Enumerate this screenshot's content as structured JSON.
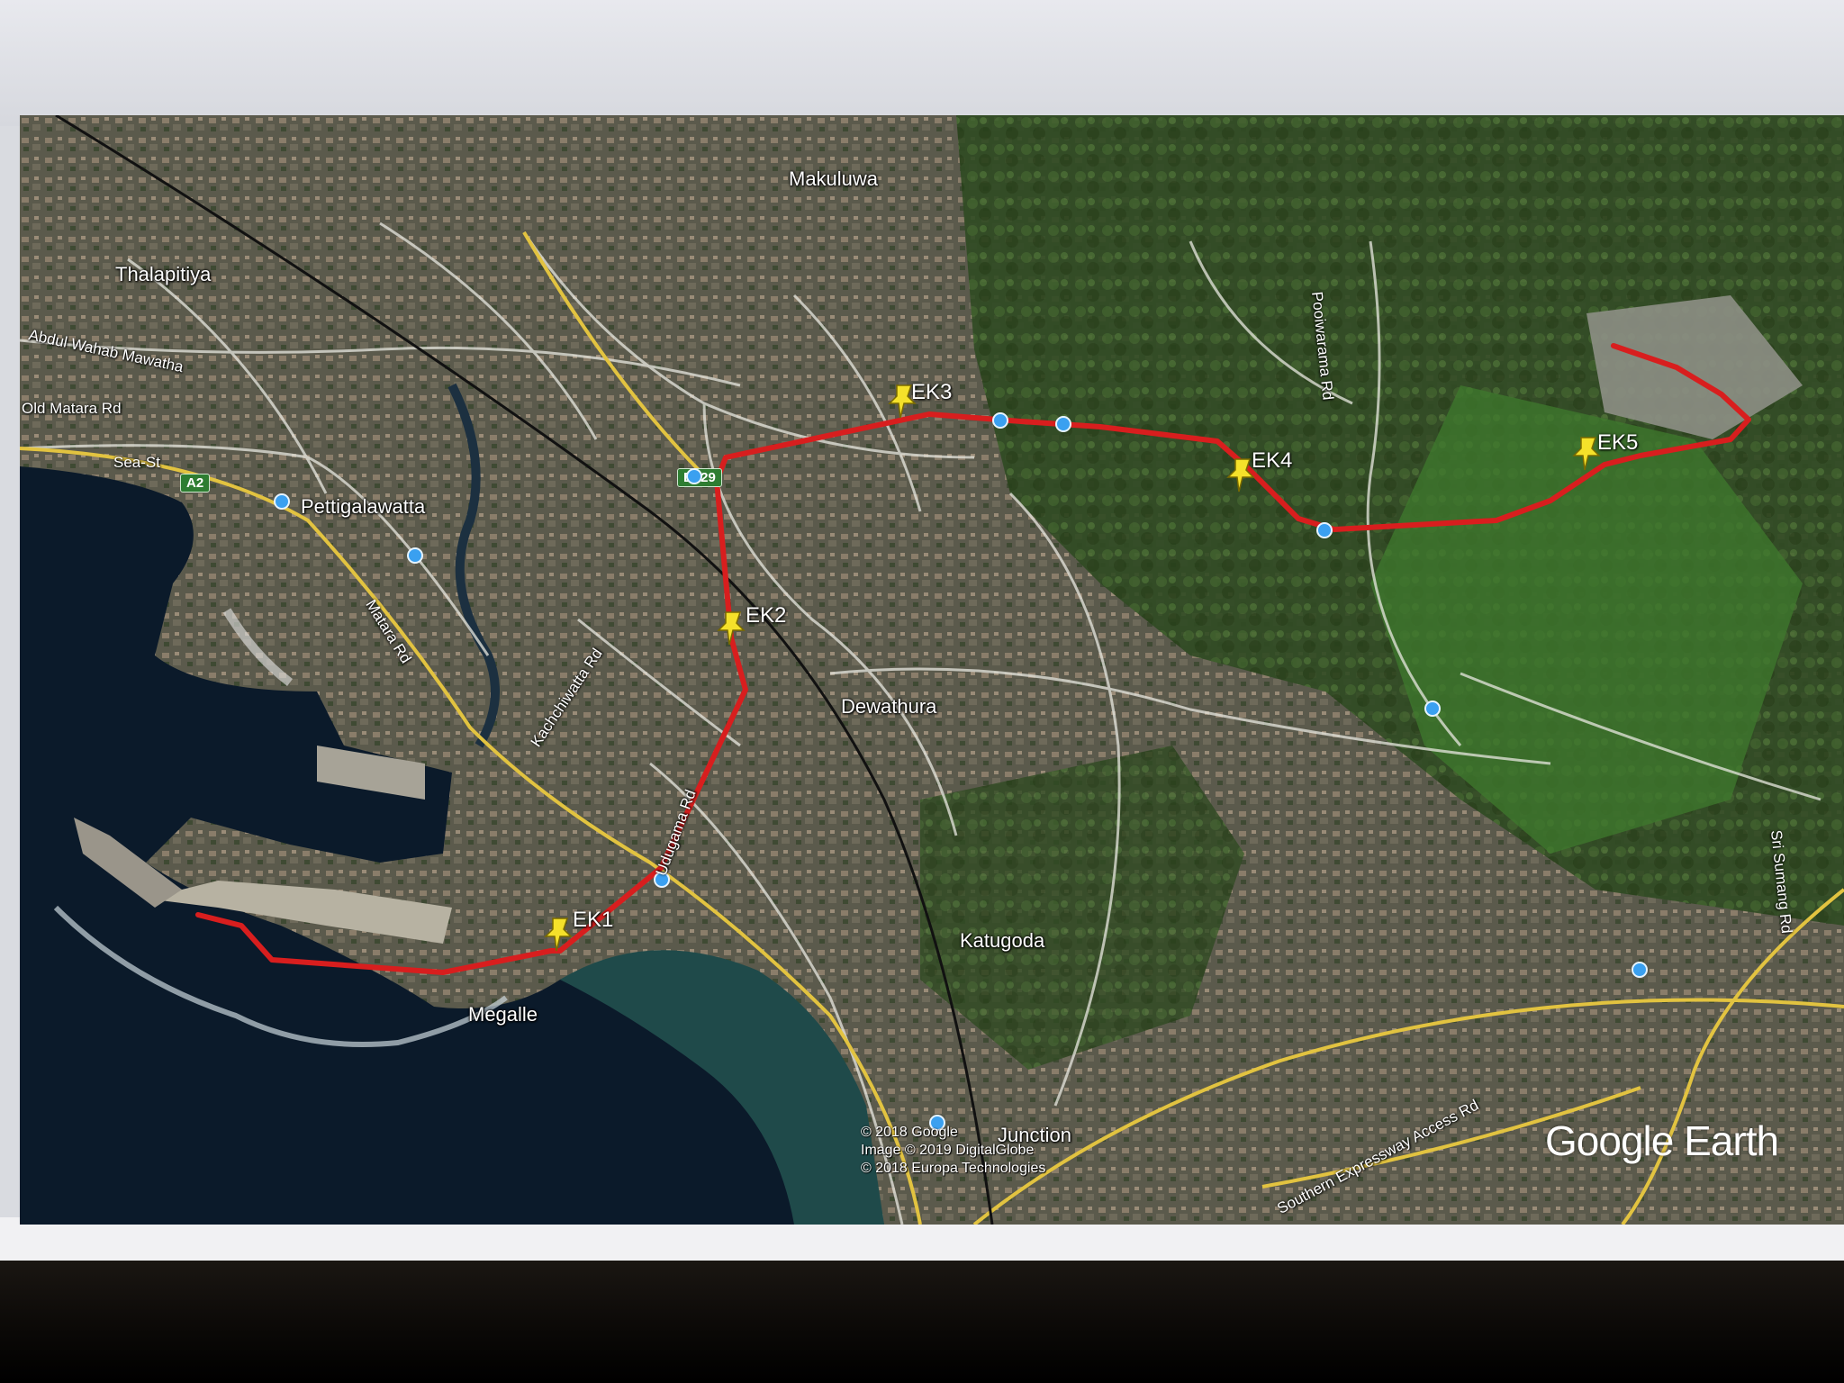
{
  "map": {
    "places": [
      {
        "name": "Makuluwa"
      },
      {
        "name": "Thalapitiya"
      },
      {
        "name": "Pettigalawatta"
      },
      {
        "name": "Dewathura"
      },
      {
        "name": "Katugoda"
      },
      {
        "name": "Megalle"
      },
      {
        "name": "Junction"
      }
    ],
    "roads": [
      {
        "name": "Abdul Wahab Mawatha"
      },
      {
        "name": "Old Matara Rd"
      },
      {
        "name": "Sea-St"
      },
      {
        "name": "Matara Rd"
      },
      {
        "name": "Kachchiwatta Rd"
      },
      {
        "name": "Udugama Rd"
      },
      {
        "name": "Pooiwarama Rd"
      },
      {
        "name": "Sri Sumang Rd"
      },
      {
        "name": "Southern Expressway Access Rd"
      }
    ],
    "shields": [
      "A2",
      "B129"
    ],
    "markers": [
      {
        "label": "EK1"
      },
      {
        "label": "EK2"
      },
      {
        "label": "EK3"
      },
      {
        "label": "EK4"
      },
      {
        "label": "EK5"
      }
    ],
    "route_color": "#d81e1e",
    "marker_color": "#f5e12a",
    "credits": [
      "© 2018 Google",
      "Image © 2019 DigitalGlobe",
      "© 2018 Europa Technologies"
    ],
    "brand": "Google Earth"
  }
}
